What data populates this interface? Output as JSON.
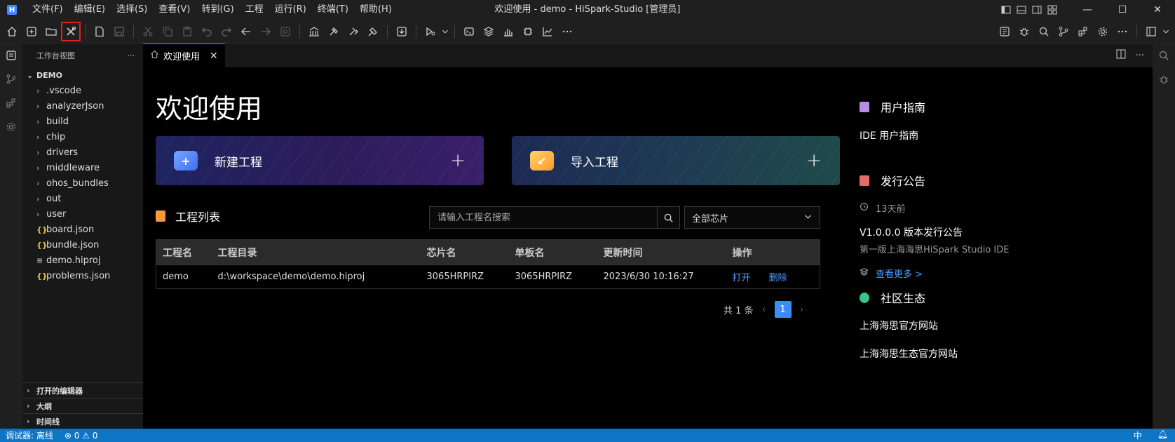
{
  "window": {
    "title": "欢迎使用 - demo - HiSpark-Studio [管理员]",
    "logo_letter": "H",
    "controls": {
      "minimize": "—",
      "maximize": "☐",
      "close": "✕"
    }
  },
  "menu": [
    "文件(F)",
    "编辑(E)",
    "选择(S)",
    "查看(V)",
    "转到(G)",
    "工程",
    "运行(R)",
    "终端(T)",
    "帮助(H)"
  ],
  "toolbar": {
    "highlighted_button": "tools-button",
    "highlight_color": "#e02020"
  },
  "explorer": {
    "header": "工作台视图",
    "more": "···",
    "root": "DEMO",
    "items": [
      {
        "name": ".vscode",
        "type": "folder"
      },
      {
        "name": "analyzerJson",
        "type": "folder"
      },
      {
        "name": "build",
        "type": "folder"
      },
      {
        "name": "chip",
        "type": "folder"
      },
      {
        "name": "drivers",
        "type": "folder"
      },
      {
        "name": "middleware",
        "type": "folder"
      },
      {
        "name": "ohos_bundles",
        "type": "folder"
      },
      {
        "name": "out",
        "type": "folder"
      },
      {
        "name": "user",
        "type": "folder"
      },
      {
        "name": "board.json",
        "type": "json"
      },
      {
        "name": "bundle.json",
        "type": "json"
      },
      {
        "name": "demo.hiproj",
        "type": "file"
      },
      {
        "name": "problems.json",
        "type": "json"
      }
    ],
    "sections": [
      "打开的编辑器",
      "大纲",
      "时间线"
    ]
  },
  "tab": {
    "label": "欢迎使用"
  },
  "welcome": {
    "title": "欢迎使用",
    "new_project": "新建工程",
    "import_project": "导入工程",
    "plus": "+",
    "project_list_title": "工程列表",
    "search_placeholder": "请输入工程名搜索",
    "chip_filter": "全部芯片",
    "table": {
      "headers": [
        "工程名",
        "工程目录",
        "芯片名",
        "单板名",
        "更新时间",
        "操作"
      ],
      "rows": [
        {
          "name": "demo",
          "dir": "d:\\workspace\\demo\\demo.hiproj",
          "chip": "3065HRPIRZ",
          "board": "3065HRPIRZ",
          "time": "2023/6/30 10:16:27",
          "open": "打开",
          "delete": "删除"
        }
      ]
    },
    "pager": {
      "total": "共 1 条",
      "page": "1"
    }
  },
  "right": {
    "guide_title": "用户指南",
    "guide_link": "IDE 用户指南",
    "release_title": "发行公告",
    "release_time": "13天前",
    "release_version": "V1.0.0.0 版本发行公告",
    "release_desc": "第一版上海海思HiSpark Studio IDE",
    "release_more": "查看更多 >",
    "community_title": "社区生态",
    "community_link1": "上海海思官方网站",
    "community_link2": "上海海思生态官方网站"
  },
  "status": {
    "debugger": "调试器: 离线",
    "problems": "⊗ 0 ⚠ 0",
    "lang": "中"
  },
  "colors": {
    "accent": "#3c8cff",
    "link": "#4b9cff",
    "statusbar": "#0e74c4"
  }
}
